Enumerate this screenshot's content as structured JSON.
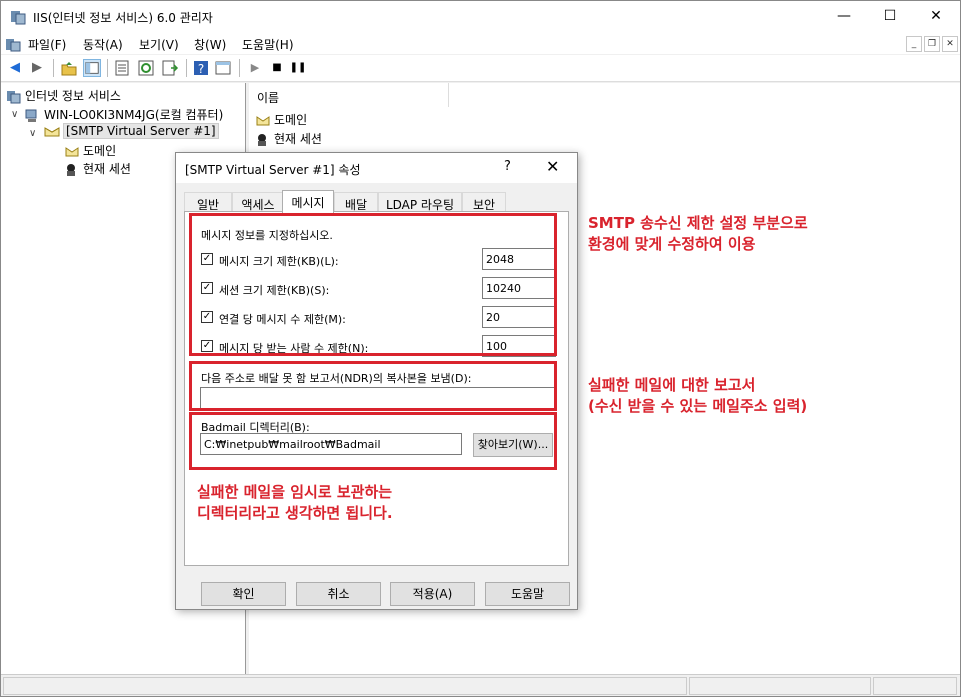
{
  "window": {
    "title": "IIS(인터넷 정보 서비스) 6.0 관리자"
  },
  "menu": [
    "파일(F)",
    "동작(A)",
    "보기(V)",
    "창(W)",
    "도움말(H)"
  ],
  "tree": {
    "root": "인터넷 정보 서비스",
    "computer": "WIN-LO0KI3NM4JG(로컬 컴퓨터)",
    "server": "[SMTP Virtual Server #1]",
    "domain": "도메인",
    "session": "현재 세션"
  },
  "list": {
    "column": "이름",
    "items": [
      "도메인",
      "현재 세션"
    ]
  },
  "dialog": {
    "title": "[SMTP Virtual Server #1] 속성",
    "help": "?",
    "close": "✕",
    "tabs": [
      "일반",
      "액세스",
      "메시지",
      "배달",
      "LDAP 라우팅",
      "보안"
    ],
    "active_tab": "메시지",
    "instruction": "메시지 정보를 지정하십시오.",
    "limits": [
      {
        "label": "메시지 크기 제한(KB)(L):",
        "checked": true,
        "value": "2048"
      },
      {
        "label": "세션 크기 제한(KB)(S):",
        "checked": true,
        "value": "10240"
      },
      {
        "label": "연결 당 메시지 수 제한(M):",
        "checked": true,
        "value": "20"
      },
      {
        "label": "메시지 당 받는 사람 수 제한(N):",
        "checked": true,
        "value": "100"
      }
    ],
    "ndr_label": "다음 주소로 배달 못 함 보고서(NDR)의 복사본을 보냄(D):",
    "ndr_value": "",
    "badmail_label": "Badmail 디렉터리(B):",
    "badmail_value": "C:₩inetpub₩mailroot₩Badmail",
    "browse_button": "찾아보기(W)...",
    "ok_button": "확인",
    "cancel_button": "취소",
    "apply_button": "적용(A)",
    "help_button": "도움말"
  },
  "annotations": {
    "smtp_note": [
      "SMTP 송수신 제한 설정 부분으로",
      "환경에 맞게 수정하여 이용"
    ],
    "ndr_note": [
      "실패한 메일에 대한 보고서",
      "(수신 받을 수 있는 메일주소 입력)"
    ],
    "badmail_note": [
      "실패한 메일을 임시로 보관하는",
      "디렉터리라고 생각하면 됩니다."
    ]
  },
  "colors": {
    "annotation": "#d9232d",
    "accent": "#0078d7"
  }
}
